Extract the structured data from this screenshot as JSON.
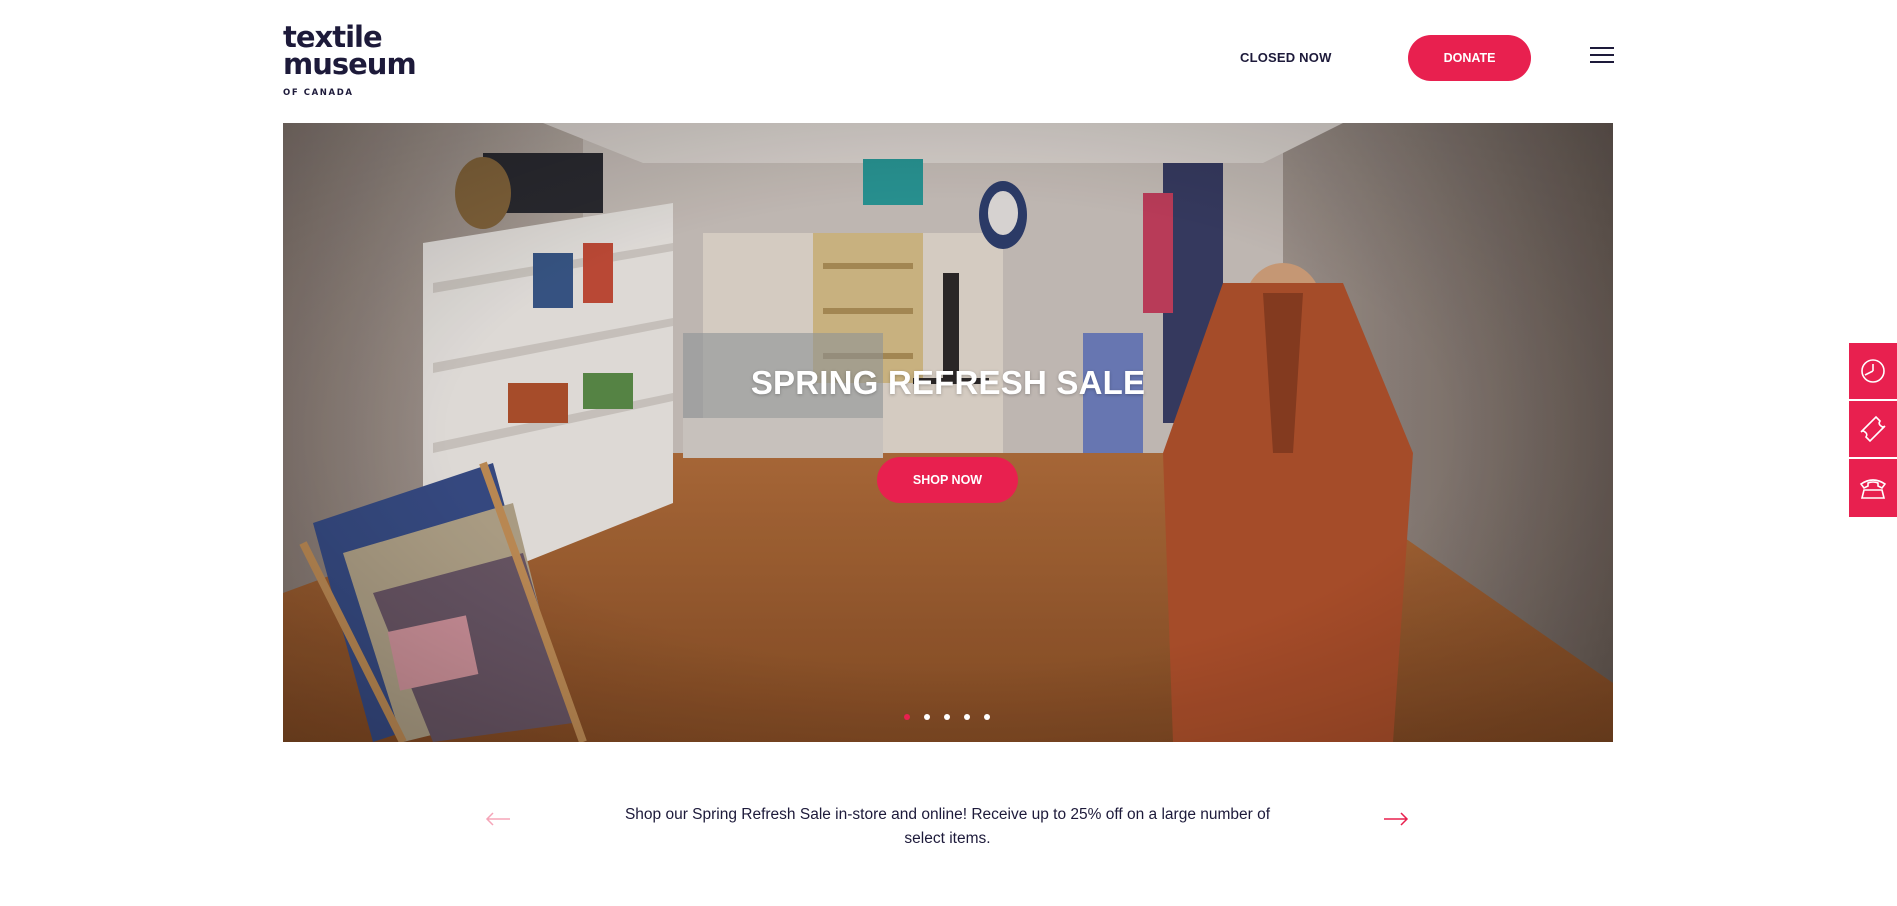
{
  "header": {
    "logo": {
      "line1": "textile",
      "line2": "museum",
      "line3": "OF CANADA"
    },
    "status": "CLOSED NOW",
    "donate_label": "DONATE",
    "menu_icon": "hamburger-menu-icon"
  },
  "hero": {
    "title": "SPRING REFRESH SALE",
    "cta_label": "SHOP NOW",
    "slide_count": 5,
    "active_slide": 1,
    "image_description_icon": "gift-shop-photo"
  },
  "slider": {
    "caption": "Shop our Spring Refresh Sale in-store and online! Receive up to 25% off on a large number of select items.",
    "prev_icon": "arrow-left-icon",
    "next_icon": "arrow-right-icon"
  },
  "side_tools": [
    {
      "icon": "clock-icon"
    },
    {
      "icon": "ticket-icon"
    },
    {
      "icon": "phone-icon"
    }
  ],
  "colors": {
    "accent": "#e8204f",
    "text": "#1d1a3a",
    "background": "#ffffff"
  }
}
